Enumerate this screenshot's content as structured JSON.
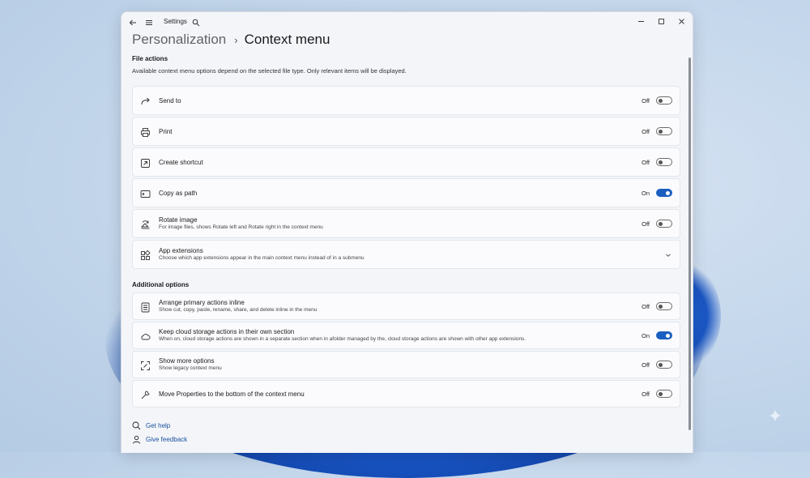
{
  "window": {
    "app_title": "Settings"
  },
  "breadcrumb": {
    "parent": "Personalization",
    "separator": "›",
    "current": "Context menu"
  },
  "file_actions": {
    "title": "File actions",
    "description": "Available context menu options depend on the selected file type. Only relevant items will be displayed.",
    "items": [
      {
        "icon": "share-arrow-icon",
        "title": "Send to",
        "subtitle": "",
        "state": "Off",
        "control": "toggle",
        "on": false
      },
      {
        "icon": "printer-icon",
        "title": "Print",
        "subtitle": "",
        "state": "Off",
        "control": "toggle",
        "on": false
      },
      {
        "icon": "shortcut-icon",
        "title": "Create shortcut",
        "subtitle": "",
        "state": "Off",
        "control": "toggle",
        "on": false
      },
      {
        "icon": "path-icon",
        "title": "Copy as path",
        "subtitle": "",
        "state": "On",
        "control": "toggle",
        "on": true
      },
      {
        "icon": "rotate-image-icon",
        "title": "Rotate image",
        "subtitle": "For image files, shows Rotate left and Rotate right in the context menu",
        "state": "Off",
        "control": "toggle",
        "on": false
      },
      {
        "icon": "app-extensions-icon",
        "title": "App extensions",
        "subtitle": "Choose which app extensions appear in the main context menu instead of in a submenu",
        "state": "",
        "control": "expand",
        "on": false
      }
    ]
  },
  "additional_options": {
    "title": "Additional options",
    "items": [
      {
        "icon": "list-icon",
        "title": "Arrange primary actions inline",
        "subtitle": "Show cut, copy, paste, rename, share, and delete inline in the menu",
        "state": "Off",
        "control": "toggle",
        "on": false
      },
      {
        "icon": "cloud-icon",
        "title": "Keep cloud storage actions in their own section",
        "subtitle": "When on, cloud storage actions are shown in a separate section when in afolder managed by the, cloud storage actions are shown with other app extensions.",
        "state": "On",
        "control": "toggle",
        "on": true
      },
      {
        "icon": "expand-icon",
        "title": "Show more options",
        "subtitle": "Show legacy context menu",
        "state": "Off",
        "control": "toggle",
        "on": false
      },
      {
        "icon": "wrench-icon",
        "title": "Move Properties to the bottom of the context menu",
        "subtitle": "",
        "state": "Off",
        "control": "toggle",
        "on": false
      }
    ]
  },
  "footer": {
    "get_help": "Get help",
    "give_feedback": "Give feedback"
  },
  "colors": {
    "accent": "#1a5fc0",
    "window_bg": "#f3f5f9",
    "card_bg": "#fbfbfd"
  }
}
